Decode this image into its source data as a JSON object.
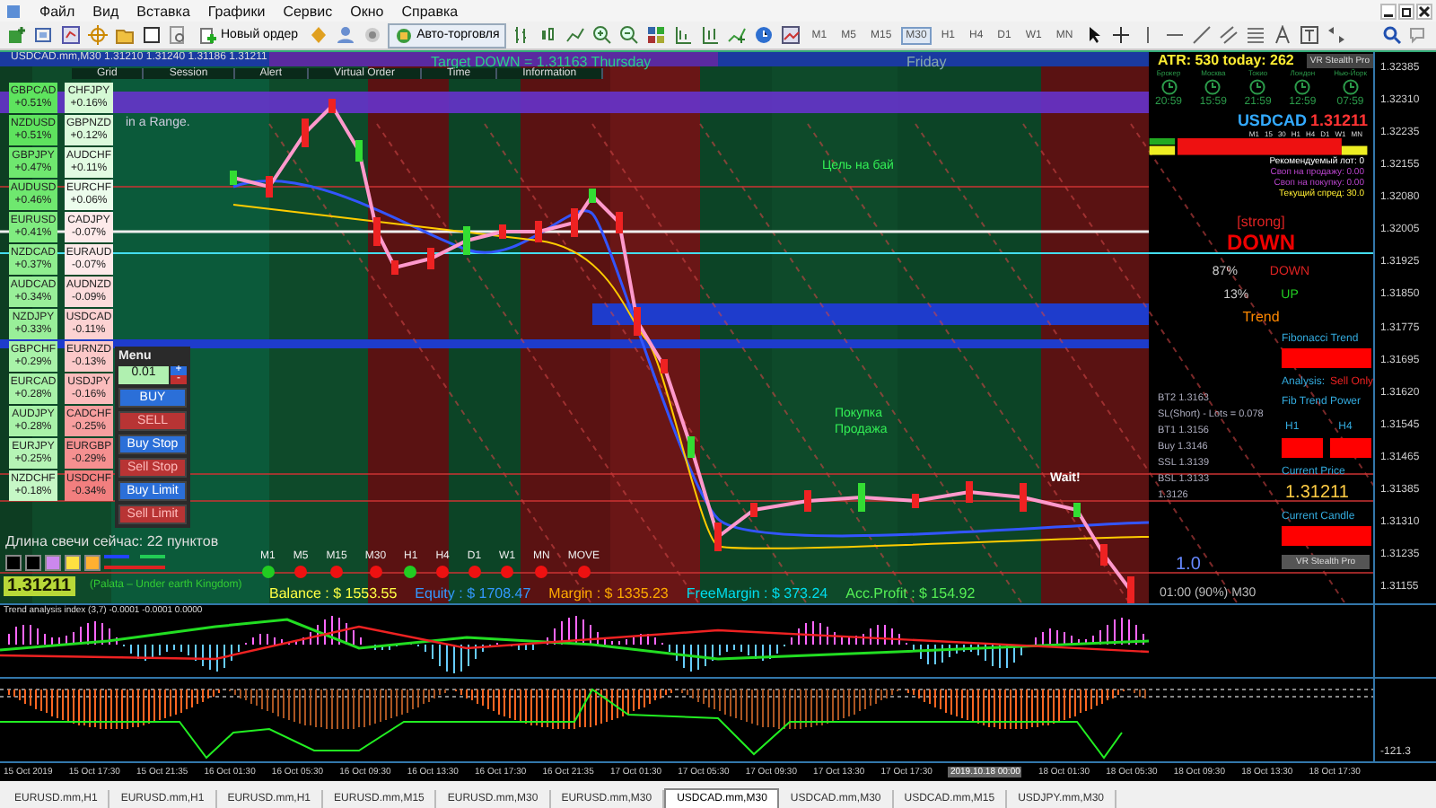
{
  "menu": [
    "Файл",
    "Вид",
    "Вставка",
    "Графики",
    "Сервис",
    "Окно",
    "Справка"
  ],
  "toolbar": {
    "new_order": "Новый ордер",
    "auto_trading": "Авто-торговля",
    "timeframes": [
      {
        "label": "M1",
        "selected": false
      },
      {
        "label": "M5",
        "selected": false
      },
      {
        "label": "M15",
        "selected": false
      },
      {
        "label": "M30",
        "selected": true
      },
      {
        "label": "H1",
        "selected": false
      },
      {
        "label": "H4",
        "selected": false
      },
      {
        "label": "D1",
        "selected": false
      },
      {
        "label": "W1",
        "selected": false
      },
      {
        "label": "MN",
        "selected": false
      }
    ]
  },
  "chart": {
    "title": "USDCAD.mm,M30  1.31210 1.31240 1.31186 1.31211",
    "target": "Target DOWN = 1.31163 Thursday",
    "day_label": "Friday",
    "range_text": "in a Range.",
    "top_buttons": [
      "Grid",
      "Session",
      "Alert",
      "Virtual Order",
      "Time",
      "Information"
    ],
    "strength_left": [
      {
        "pair": "GBPCAD",
        "change": "+0.51%",
        "color": "#5ee35e"
      },
      {
        "pair": "NZDUSD",
        "change": "+0.51%",
        "color": "#5ee35e"
      },
      {
        "pair": "GBPJPY",
        "change": "+0.47%",
        "color": "#6fe86f"
      },
      {
        "pair": "AUDUSD",
        "change": "+0.46%",
        "color": "#6fe86f"
      },
      {
        "pair": "EURUSD",
        "change": "+0.41%",
        "color": "#80eb80"
      },
      {
        "pair": "NZDCAD",
        "change": "+0.37%",
        "color": "#8fee8f"
      },
      {
        "pair": "AUDCAD",
        "change": "+0.34%",
        "color": "#99ef99"
      },
      {
        "pair": "NZDJPY",
        "change": "+0.33%",
        "color": "#99ef99"
      },
      {
        "pair": "GBPCHF",
        "change": "+0.29%",
        "color": "#a8f2a8"
      },
      {
        "pair": "EURCAD",
        "change": "+0.28%",
        "color": "#a8f2a8"
      },
      {
        "pair": "AUDJPY",
        "change": "+0.28%",
        "color": "#a8f2a8"
      },
      {
        "pair": "EURJPY",
        "change": "+0.25%",
        "color": "#b5f4b5"
      },
      {
        "pair": "NZDCHF",
        "change": "+0.18%",
        "color": "#c6f7c6"
      }
    ],
    "strength_right": [
      {
        "pair": "CHFJPY",
        "change": "+0.16%",
        "color": "#d4f9d4"
      },
      {
        "pair": "GBPNZD",
        "change": "+0.12%",
        "color": "#dcfadc"
      },
      {
        "pair": "AUDCHF",
        "change": "+0.11%",
        "color": "#e2fbe2"
      },
      {
        "pair": "EURCHF",
        "change": "+0.06%",
        "color": "#ecfcec"
      },
      {
        "pair": "CADJPY",
        "change": "-0.07%",
        "color": "#fdeaea"
      },
      {
        "pair": "EURAUD",
        "change": "-0.07%",
        "color": "#fdeaea"
      },
      {
        "pair": "AUDNZD",
        "change": "-0.09%",
        "color": "#fcdcdc"
      },
      {
        "pair": "USDCAD",
        "change": "-0.11%",
        "color": "#fcd2d2"
      },
      {
        "pair": "EURNZD",
        "change": "-0.13%",
        "color": "#fbc8c8"
      },
      {
        "pair": "USDJPY",
        "change": "-0.16%",
        "color": "#fabcbc"
      },
      {
        "pair": "CADCHF",
        "change": "-0.25%",
        "color": "#f79f9f"
      },
      {
        "pair": "EURGBP",
        "change": "-0.29%",
        "color": "#f59090"
      },
      {
        "pair": "USDCHF",
        "change": "-0.34%",
        "color": "#f27f7f"
      }
    ],
    "trade_menu": {
      "title": "Menu",
      "lot": "0.01",
      "plus": "+",
      "minus": "-",
      "buttons": [
        {
          "label": "BUY",
          "kind": "buy"
        },
        {
          "label": "SELL",
          "kind": "sell"
        },
        {
          "label": "Buy Stop",
          "kind": "buy"
        },
        {
          "label": "Sell Stop",
          "kind": "sell"
        },
        {
          "label": "Buy Limit",
          "kind": "buy"
        },
        {
          "label": "Sell Limit",
          "kind": "sell"
        }
      ]
    },
    "candle_length": "Длина свечи сейчас: 22 пунктов",
    "palette": [
      {
        "color": "#000000"
      },
      {
        "color": "#000000"
      },
      {
        "color": "#cc88ee"
      },
      {
        "color": "#ffe040"
      },
      {
        "color": "#ffb030"
      }
    ],
    "big_price": "1.31211",
    "palette_text": "(Palata – Under earth Kingdom)",
    "tf_signals": [
      {
        "label": "M1",
        "color": "#22cc22"
      },
      {
        "label": "M5",
        "color": "#ee1111"
      },
      {
        "label": "M15",
        "color": "#ee1111"
      },
      {
        "label": "M30",
        "color": "#ee1111"
      },
      {
        "label": "H1",
        "color": "#22cc22"
      },
      {
        "label": "H4",
        "color": "#ee1111"
      },
      {
        "label": "D1",
        "color": "#ee1111"
      },
      {
        "label": "W1",
        "color": "#ee1111"
      },
      {
        "label": "MN",
        "color": "#ee1111"
      },
      {
        "label": "MOVE",
        "color": "#ee1111"
      }
    ],
    "account": [
      {
        "text": "Balance : $ 1553.55",
        "color": "#ffff44"
      },
      {
        "text": "Equity : $ 1708.47",
        "color": "#3399ff"
      },
      {
        "text": "Margin : $ 1335.23",
        "color": "#ffaa00"
      },
      {
        "text": "FreeMargin : $ 373.24",
        "color": "#00ddee"
      },
      {
        "text": "Acc.Profit : $ 154.92",
        "color": "#55ee55"
      }
    ],
    "labels": {
      "buy_target": "Цель на бай",
      "buy": "Покупка",
      "sell": "Продажа",
      "wait": "Wait!",
      "ratio": "1.0",
      "candle_timer": "01:00 (90%) M30"
    },
    "levels": [
      {
        "text": "BT2 1.3163"
      },
      {
        "text": "SL(Short) - Lots = 0.078"
      },
      {
        "text": "BT1 1.3156"
      },
      {
        "text": "Buy 1.3146"
      },
      {
        "text": "SSL 1.3139"
      },
      {
        "text": "BSL 1.3133"
      },
      {
        "text": "1.3126"
      }
    ]
  },
  "panel": {
    "atr": "ATR: 530  today: 262",
    "brand": "VR Stealth Pro",
    "clocks": [
      {
        "city": "Брокер",
        "time": "20:59"
      },
      {
        "city": "Москва",
        "time": "15:59"
      },
      {
        "city": "Токио",
        "time": "21:59"
      },
      {
        "city": "Лондон",
        "time": "12:59"
      },
      {
        "city": "Нью-Йорк",
        "time": "07:59"
      }
    ],
    "symbol": "USDCAD",
    "price": "1.31211",
    "tfs": [
      "M1",
      "15",
      "30",
      "H1",
      "H4",
      "D1",
      "W1",
      "MN"
    ],
    "info": [
      "Рекомендуемый лот: 0",
      "Своп на продажу: 0.00",
      "Своп на покупку: 0.00",
      "Текущий спред: 30.0"
    ],
    "strength_tag": "[strong]",
    "direction": "DOWN",
    "down_pct": "87%",
    "down_label": "DOWN",
    "up_pct": "13%",
    "up_label": "UP",
    "trend": "Trend",
    "fib_trend": "Fibonacci Trend",
    "analysis": "Analysis:",
    "analysis_value": "Sell Only",
    "fib_power": "Fib Trend Power",
    "h1": "H1",
    "h4": "H4",
    "current_price_label": "Current Price",
    "current_price": "1.31211",
    "current_candle": "Current Candle",
    "footer": "VR Stealth Pro"
  },
  "price_axis": [
    "1.32385",
    "1.32310",
    "1.32235",
    "1.32155",
    "1.32080",
    "1.32005",
    "1.31925",
    "1.31850",
    "1.31775",
    "1.31695",
    "1.31620",
    "1.31545",
    "1.31465",
    "1.31385",
    "1.31310",
    "1.31235",
    "1.31155"
  ],
  "indicator_1": {
    "title": "Trend analysis index (3,7) -0.0001 -0.0001 0.0000"
  },
  "indicator_2": {
    "axis": "-121.3"
  },
  "time_axis": [
    {
      "label": "15 Oct 2019",
      "selected": false
    },
    {
      "label": "15 Oct 17:30",
      "selected": false
    },
    {
      "label": "15 Oct 21:35",
      "selected": false
    },
    {
      "label": "16 Oct 01:30",
      "selected": false
    },
    {
      "label": "16 Oct 05:30",
      "selected": false
    },
    {
      "label": "16 Oct 09:30",
      "selected": false
    },
    {
      "label": "16 Oct 13:30",
      "selected": false
    },
    {
      "label": "16 Oct 17:30",
      "selected": false
    },
    {
      "label": "16 Oct 21:35",
      "selected": false
    },
    {
      "label": "17 Oct 01:30",
      "selected": false
    },
    {
      "label": "17 Oct 05:30",
      "selected": false
    },
    {
      "label": "17 Oct 09:30",
      "selected": false
    },
    {
      "label": "17 Oct 13:30",
      "selected": false
    },
    {
      "label": "17 Oct 17:30",
      "selected": false
    },
    {
      "label": "2019.10.18 00:00",
      "selected": true
    },
    {
      "label": "18 Oct 01:30",
      "selected": false
    },
    {
      "label": "18 Oct 05:30",
      "selected": false
    },
    {
      "label": "18 Oct 09:30",
      "selected": false
    },
    {
      "label": "18 Oct 13:30",
      "selected": false
    },
    {
      "label": "18 Oct 17:30",
      "selected": false
    }
  ],
  "tabs": [
    {
      "label": "EURUSD.mm,H1",
      "selected": false
    },
    {
      "label": "EURUSD.mm,H1",
      "selected": false
    },
    {
      "label": "EURUSD.mm,H1",
      "selected": false
    },
    {
      "label": "EURUSD.mm,M15",
      "selected": false
    },
    {
      "label": "EURUSD.mm,M30",
      "selected": false
    },
    {
      "label": "EURUSD.mm,M30",
      "selected": false
    },
    {
      "label": "USDCAD.mm,M30",
      "selected": true
    },
    {
      "label": "USDCAD.mm,M30",
      "selected": false
    },
    {
      "label": "USDCAD.mm,M15",
      "selected": false
    },
    {
      "label": "USDJPY.mm,M30",
      "selected": false
    }
  ]
}
